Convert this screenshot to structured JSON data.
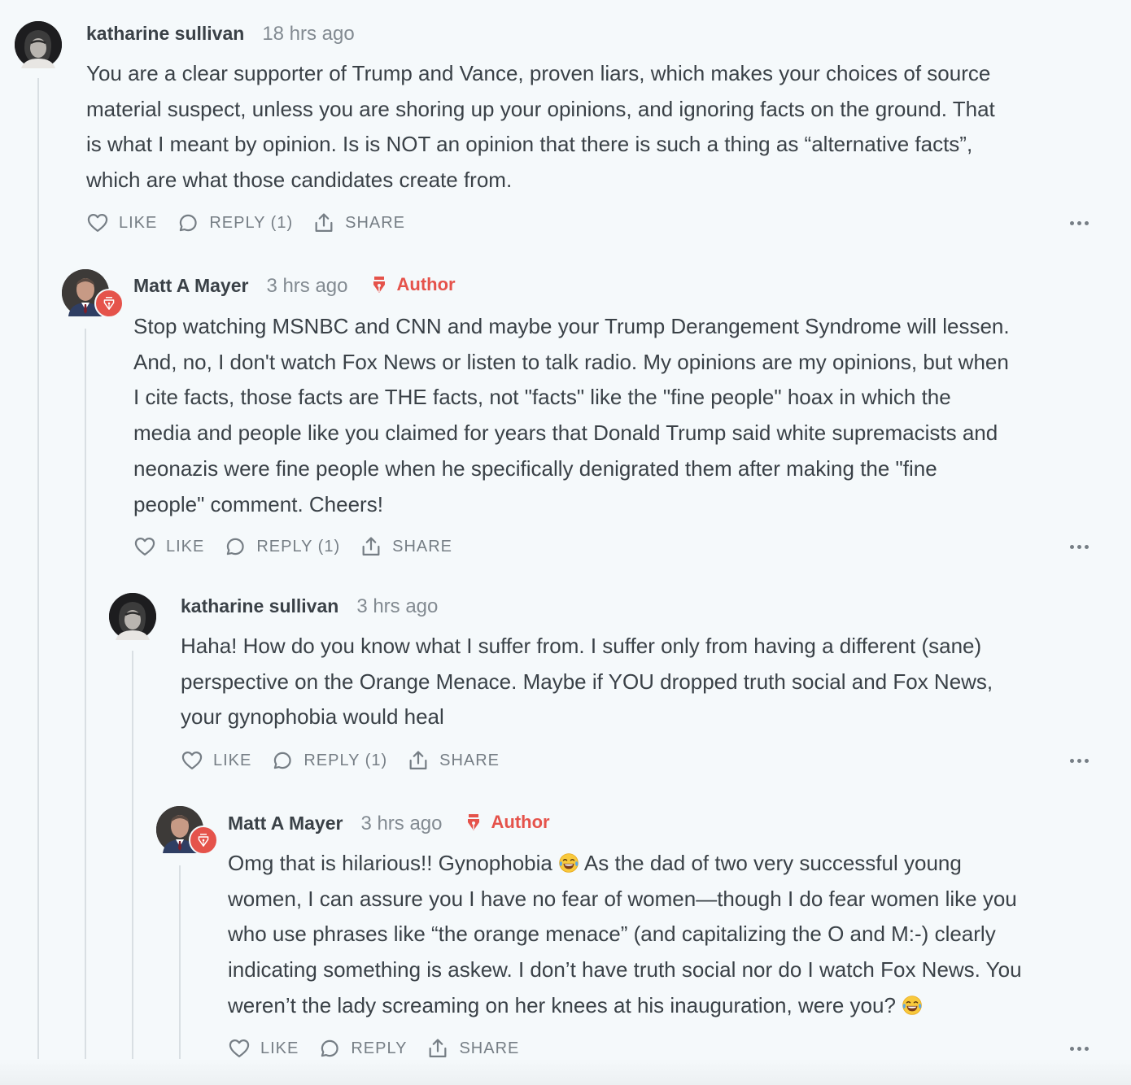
{
  "comments": [
    {
      "author": "katharine sullivan",
      "time": "18 hrs ago",
      "is_author": false,
      "lines": [
        "You are a clear supporter of Trump and Vance, proven liars, which makes your choices of source",
        "material suspect, unless you are shoring up your opinions, and ignoring facts on the ground. That",
        "is what I meant by opinion. Is is NOT an opinion that there is such a thing as “alternative facts”,",
        "which are what those candidates create from."
      ],
      "like_label": "LIKE",
      "reply_label": "REPLY (1)",
      "share_label": "SHARE"
    },
    {
      "author": "Matt A Mayer",
      "time": "3 hrs ago",
      "is_author": true,
      "author_label": "Author",
      "lines": [
        "Stop watching MSNBC and CNN and maybe your Trump Derangement Syndrome will lessen.",
        "And, no, I don't watch Fox News or listen to talk radio. My opinions are my opinions, but when",
        "I cite facts, those facts are THE facts, not \"facts\" like the \"fine people\" hoax in which the",
        "media and people like you claimed for years that Donald Trump said white supremacists and",
        "neonazis were fine people when he specifically denigrated them after making the \"fine",
        "people\" comment. Cheers!"
      ],
      "like_label": "LIKE",
      "reply_label": "REPLY (1)",
      "share_label": "SHARE"
    },
    {
      "author": "katharine sullivan",
      "time": "3 hrs ago",
      "is_author": false,
      "lines": [
        "Haha! How do you know what I suffer from. I suffer only from having a different (sane)",
        "perspective on the Orange Menace. Maybe if YOU dropped truth social and Fox News,",
        "your gynophobia would heal"
      ],
      "like_label": "LIKE",
      "reply_label": "REPLY (1)",
      "share_label": "SHARE"
    },
    {
      "author": "Matt A Mayer",
      "time": "3 hrs ago",
      "is_author": true,
      "author_label": "Author",
      "line1_before_emoji": "Omg that is hilarious!! Gynophobia",
      "line1_after_emoji": "As the dad of two very successful young",
      "lines": [
        "women, I can assure you I have no fear of women—though I do fear women like you",
        "who use phrases like “the orange menace” (and capitalizing the O and M:-) clearly",
        "indicating something is askew. I don’t have truth social nor do I watch Fox News. You"
      ],
      "last_line": "weren’t the lady screaming on her knees at his inauguration, were you?",
      "emoji": "face-with-tears-of-joy",
      "like_label": "LIKE",
      "reply_label": "REPLY",
      "share_label": "SHARE"
    }
  ],
  "colors": {
    "background": "#f5f9fb",
    "text": "#3a4147",
    "muted": "#828a91",
    "accent": "#e5534b"
  },
  "icons": {
    "like": "heart-icon",
    "reply": "speech-bubble-icon",
    "share": "share-icon",
    "more": "ellipsis-icon",
    "author": "pen-nib-icon"
  }
}
